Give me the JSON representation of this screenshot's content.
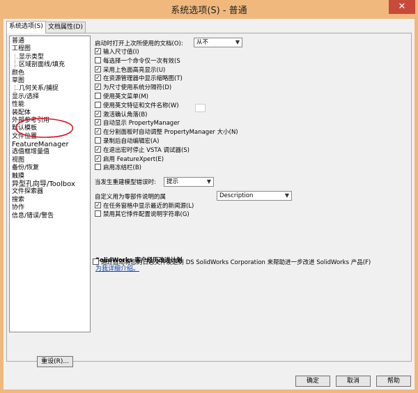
{
  "window": {
    "title": "系统选项(S) - 普通",
    "close": "✕"
  },
  "tabs": [
    {
      "label": "系统选项(S)"
    },
    {
      "label": "文档属性(D)"
    }
  ],
  "tree": {
    "items": [
      {
        "label": "普通",
        "level": 0
      },
      {
        "label": "工程图",
        "level": 0
      },
      {
        "label": "显示类型",
        "level": 1
      },
      {
        "label": "区域剖面线/填充",
        "level": 1
      },
      {
        "label": "颜色",
        "level": 0
      },
      {
        "label": "草图",
        "level": 0
      },
      {
        "label": "几何关系/捕捉",
        "level": 1
      },
      {
        "label": "显示/选择",
        "level": 0
      },
      {
        "label": "性能",
        "level": 0
      },
      {
        "label": "装配体",
        "level": 0
      },
      {
        "label": "外部参考引用",
        "level": 0
      },
      {
        "label": "默认模板",
        "level": 0
      },
      {
        "label": "文件位置",
        "level": 0
      },
      {
        "label": "FeatureManager",
        "level": 0
      },
      {
        "label": "选值框增量值",
        "level": 0
      },
      {
        "label": "视图",
        "level": 0
      },
      {
        "label": "备份/恢复",
        "level": 0
      },
      {
        "label": "触摸",
        "level": 0
      },
      {
        "label": "异型孔向导/Toolbox",
        "level": 0
      },
      {
        "label": "文件探索器",
        "level": 0
      },
      {
        "label": "搜索",
        "level": 0
      },
      {
        "label": "协作",
        "level": 0
      },
      {
        "label": "信息/错误/警告",
        "level": 0
      }
    ],
    "reset_label": "重设(R)..."
  },
  "options": {
    "open_last_label": "启动时打开上次所使用的文档(O):",
    "open_last_value": "从不",
    "checks": [
      {
        "label": "输入尺寸值(I)",
        "checked": true
      },
      {
        "label": "每选择一个命令仅一次有效(S",
        "checked": false
      },
      {
        "label": "采用上色面高亮显示(U)",
        "checked": true
      },
      {
        "label": "在资源管理器中显示缩略图(T)",
        "checked": true
      },
      {
        "label": "为尺寸使用系统分隔符(D)",
        "checked": true
      },
      {
        "label": "使用英文菜单(M)",
        "checked": false
      },
      {
        "label": "使用英文特征和文件名称(W)",
        "checked": false
      },
      {
        "label": "激活确认角落(B)",
        "checked": true
      },
      {
        "label": "自动显示 PropertyManager",
        "checked": true
      },
      {
        "label": "在分割面板时自动调整 PropertyManager 大小(N)",
        "checked": true
      },
      {
        "label": "录制后自动编辑宏(A)",
        "checked": false
      },
      {
        "label": "在退出宏时停止 VSTA 调试器(S)",
        "checked": true
      },
      {
        "label": "启用 FeatureXpert(E)",
        "checked": true
      },
      {
        "label": "启用冻结栏(B)",
        "checked": false
      }
    ],
    "rebuild_label": "当发生重建模型错误时:",
    "rebuild_value": "提示",
    "custom_prop_label": "自定义用为零部件说明的属",
    "custom_prop_value": "Description",
    "checks2": [
      {
        "label": "在任务窗格中显示最近的新闻源(L)",
        "checked": true
      },
      {
        "label": "禁用其它悸件配置说明字符串(G)",
        "checked": false
      }
    ],
    "cep_title": "SolidWorks 客户经历改进计划",
    "cep_link": "为我详细介绍。",
    "cep_check": {
      "label": "通过自动将您的日志文件发送到 DS SolidWorks Corporation 来帮助进一步改进 SolidWorks 产品(F)",
      "checked": false
    }
  },
  "buttons": {
    "ok": "确定",
    "cancel": "取消",
    "help": "帮助"
  },
  "colors": {
    "titlebar": "#f0b87c",
    "close": "#c74a3b",
    "annotation": "#d8142a"
  }
}
